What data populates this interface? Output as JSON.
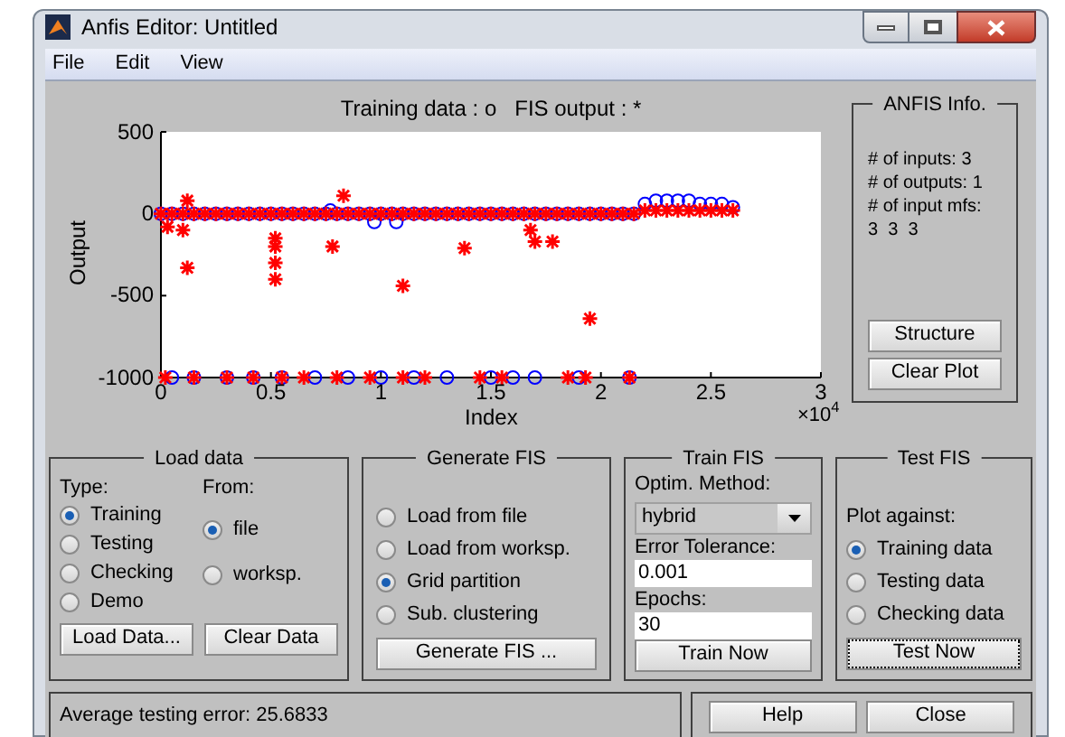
{
  "window": {
    "title": "Anfis Editor: Untitled"
  },
  "menu": [
    "File",
    "Edit",
    "View"
  ],
  "plot": {
    "chart_data": {
      "type": "scatter",
      "title": "Training data : o   FIS output : *",
      "xlabel": "Index",
      "ylabel": "Output",
      "xlim": [
        0,
        3
      ],
      "ylim": [
        -1000,
        500
      ],
      "xticks": [
        0,
        0.5,
        1,
        1.5,
        2,
        2.5,
        3
      ],
      "yticks": [
        -1000,
        -500,
        0,
        500
      ],
      "annotations": [
        "×10$^{4}$"
      ],
      "series": [
        {
          "color": "#0000ff",
          "marker": "circle",
          "x": [
            0,
            0.05,
            0.1,
            0.15,
            0.2,
            0.25,
            0.3,
            0.35,
            0.4,
            0.45,
            0.5,
            0.55,
            0.6,
            0.65,
            0.7,
            0.75,
            0.8,
            0.85,
            0.9,
            0.95,
            1,
            1.05,
            1.1,
            1.15,
            1.2,
            1.25,
            1.3,
            1.35,
            1.4,
            1.45,
            1.5,
            1.55,
            1.6,
            1.65,
            1.7,
            1.75,
            1.8,
            1.85,
            1.9,
            1.95,
            2,
            2.05,
            2.1,
            2.15,
            0.77,
            0.97,
            1.07,
            2.2,
            2.25,
            2.3,
            2.35,
            2.4,
            2.45,
            2.5,
            2.55,
            2.6,
            0.05,
            0.15,
            0.3,
            0.42,
            0.55,
            0.7,
            0.85,
            1.0,
            1.15,
            1.3,
            1.5,
            1.6,
            1.7,
            1.9,
            2.13
          ],
          "values": [
            0,
            0,
            0,
            0,
            0,
            0,
            0,
            0,
            0,
            0,
            0,
            0,
            0,
            0,
            0,
            0,
            0,
            0,
            0,
            0,
            0,
            0,
            0,
            0,
            0,
            0,
            0,
            0,
            0,
            0,
            0,
            0,
            0,
            0,
            0,
            0,
            0,
            0,
            0,
            0,
            0,
            0,
            0,
            0,
            20,
            -50,
            -50,
            60,
            80,
            80,
            80,
            80,
            60,
            60,
            60,
            40,
            -1000,
            -1000,
            -1000,
            -1000,
            -1000,
            -1000,
            -1000,
            -1000,
            -1000,
            -1000,
            -1000,
            -1000,
            -1000,
            -1000,
            -1000
          ]
        },
        {
          "color": "#ff0000",
          "marker": "cross",
          "x": [
            0,
            0.05,
            0.1,
            0.15,
            0.2,
            0.25,
            0.3,
            0.35,
            0.4,
            0.45,
            0.5,
            0.55,
            0.6,
            0.65,
            0.7,
            0.75,
            0.8,
            0.85,
            0.9,
            0.95,
            1,
            1.05,
            1.1,
            1.15,
            1.2,
            1.25,
            1.3,
            1.35,
            1.4,
            1.45,
            1.5,
            1.55,
            1.6,
            1.65,
            1.7,
            1.75,
            1.8,
            1.85,
            1.9,
            1.95,
            2,
            2.05,
            2.1,
            2.15,
            2.2,
            2.25,
            2.3,
            2.35,
            2.4,
            2.45,
            2.5,
            2.55,
            2.6,
            0.03,
            0.1,
            0.12,
            0.12,
            0.52,
            0.52,
            0.52,
            0.52,
            0.78,
            0.83,
            1.1,
            1.38,
            1.68,
            1.7,
            1.78,
            1.95,
            0.02,
            0.15,
            0.3,
            0.42,
            0.55,
            0.65,
            0.8,
            0.95,
            1.1,
            1.2,
            1.45,
            1.55,
            1.85,
            1.93,
            2.13
          ],
          "values": [
            0,
            0,
            0,
            0,
            0,
            0,
            0,
            0,
            0,
            0,
            0,
            0,
            0,
            0,
            0,
            0,
            0,
            0,
            0,
            0,
            0,
            0,
            0,
            0,
            0,
            0,
            0,
            0,
            0,
            0,
            0,
            0,
            0,
            0,
            0,
            0,
            0,
            0,
            0,
            0,
            0,
            0,
            0,
            0,
            20,
            20,
            20,
            20,
            20,
            20,
            20,
            20,
            20,
            -80,
            -100,
            -330,
            80,
            -150,
            -200,
            -300,
            -400,
            -200,
            110,
            -440,
            -210,
            -100,
            -170,
            -170,
            -640,
            -1000,
            -1000,
            -1000,
            -1000,
            -1000,
            -1000,
            -1000,
            -1000,
            -1000,
            -1000,
            -1000,
            -1000,
            -1000,
            -1000,
            -1000
          ]
        }
      ]
    }
  },
  "anfis_info": {
    "title": "ANFIS Info.",
    "lines": [
      "# of inputs: 3",
      "# of outputs: 1",
      "# of input mfs:",
      "3  3  3"
    ],
    "buttons": [
      "Structure",
      "Clear Plot"
    ]
  },
  "load_data": {
    "title": "Load data",
    "type_label": "Type:",
    "from_label": "From:",
    "types": [
      {
        "label": "Training",
        "selected": true
      },
      {
        "label": "Testing",
        "selected": false
      },
      {
        "label": "Checking",
        "selected": false
      },
      {
        "label": "Demo",
        "selected": false
      }
    ],
    "sources": [
      {
        "label": "file",
        "selected": true
      },
      {
        "label": "worksp.",
        "selected": false
      }
    ],
    "buttons": [
      "Load Data...",
      "Clear Data"
    ]
  },
  "generate_fis": {
    "title": "Generate FIS",
    "options": [
      {
        "label": "Load from file",
        "selected": false
      },
      {
        "label": "Load from worksp.",
        "selected": false
      },
      {
        "label": "Grid partition",
        "selected": true
      },
      {
        "label": "Sub. clustering",
        "selected": false
      }
    ],
    "button": "Generate FIS ..."
  },
  "train_fis": {
    "title": "Train FIS",
    "method_label": "Optim. Method:",
    "method": "hybrid",
    "tolerance_label": "Error Tolerance:",
    "tolerance": "0.001",
    "epochs_label": "Epochs:",
    "epochs": "30",
    "button": "Train Now"
  },
  "test_fis": {
    "title": "Test FIS",
    "plot_label": "Plot against:",
    "options": [
      {
        "label": "Training data",
        "selected": true
      },
      {
        "label": "Testing data",
        "selected": false
      },
      {
        "label": "Checking data",
        "selected": false
      }
    ],
    "button": "Test Now"
  },
  "status": "Average testing error: 25.6833",
  "buttons": [
    "Help",
    "Close"
  ]
}
